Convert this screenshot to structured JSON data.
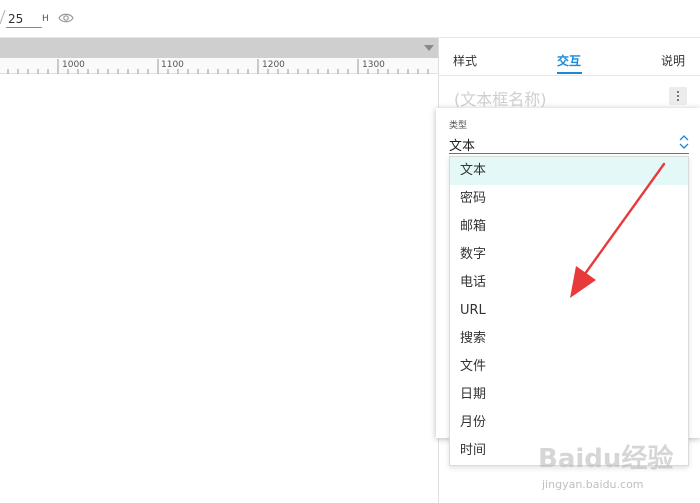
{
  "toolbar": {
    "height_value": "25",
    "height_unit": "H",
    "visibility_icon": "eye-icon"
  },
  "ruler": {
    "labels": [
      "1000",
      "1100",
      "1200",
      "1300"
    ]
  },
  "panel": {
    "tabs": [
      {
        "label": "样式"
      },
      {
        "label": "交互"
      },
      {
        "label": "说明"
      }
    ],
    "active_tab": "交互",
    "widget_name": "(文本框名称)",
    "more_icon": "more-vertical-icon"
  },
  "type_select": {
    "label": "类型",
    "value": "文本",
    "options": [
      "文本",
      "密码",
      "邮箱",
      "数字",
      "电话",
      "URL",
      "搜索",
      "文件",
      "日期",
      "月份",
      "时间"
    ],
    "selected": "文本"
  },
  "watermark": {
    "brand": "Baidu经验",
    "url": "jingyan.baidu.com"
  },
  "colors": {
    "accent": "#1a8ad8",
    "selected_option_bg": "#e4f8f8",
    "annotation_arrow": "#e83a3a"
  }
}
